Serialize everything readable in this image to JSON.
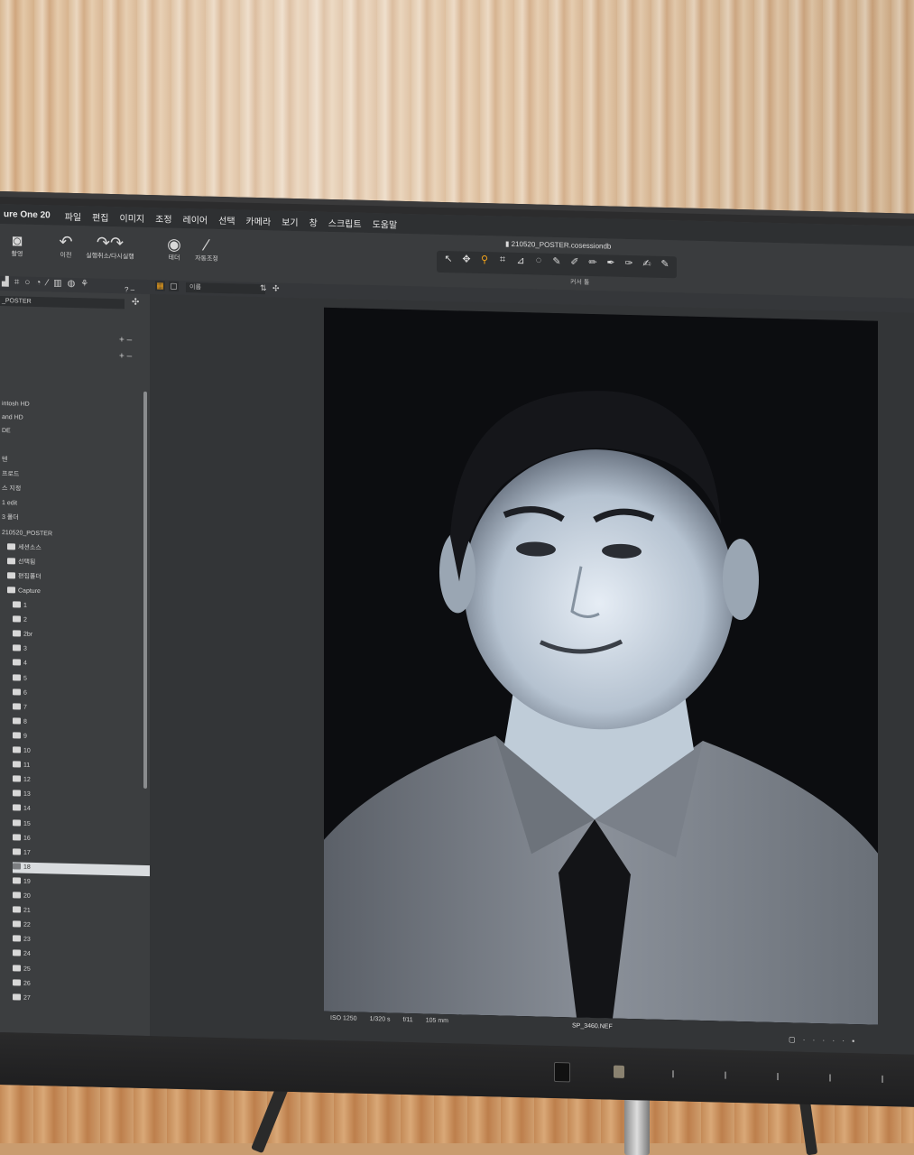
{
  "menubar": {
    "app_name": "ure One 20",
    "items": [
      "파일",
      "편집",
      "이미지",
      "조정",
      "레이어",
      "선택",
      "카메라",
      "보기",
      "창",
      "스크립트",
      "도움말"
    ]
  },
  "toolbar": {
    "document_title": "210520_POSTER.cosessiondb",
    "buttons": [
      {
        "label": "촬영",
        "icon": "camera-icon"
      },
      {
        "label": "이전",
        "icon": "undo-icon"
      },
      {
        "label": "실행취소/다시실행",
        "icon": "redo-icon"
      },
      {
        "label": "테더",
        "icon": "tether-icon"
      },
      {
        "label": "자동조정",
        "icon": "wand-icon"
      }
    ],
    "cursor_tools_label": "커서 툴"
  },
  "subbar": {
    "sort_value": "이름"
  },
  "library": {
    "session_name": "_POSTER",
    "rows": [
      {
        "label": "intosh HD",
        "folder": false,
        "selected": false
      },
      {
        "label": "and HD",
        "folder": false,
        "selected": false
      },
      {
        "label": "DE",
        "folder": false,
        "selected": false
      },
      {
        "label": "텐",
        "folder": false,
        "selected": false
      },
      {
        "label": "프로드",
        "folder": false,
        "selected": false
      },
      {
        "label": "스 지정",
        "folder": false,
        "selected": false
      },
      {
        "label": "1 edit",
        "folder": false,
        "selected": false
      },
      {
        "label": "3 폴더",
        "folder": false,
        "selected": false
      },
      {
        "label": "210520_POSTER",
        "folder": false,
        "selected": false
      },
      {
        "label": "세션소스",
        "folder": true,
        "selected": false
      },
      {
        "label": "선택됨",
        "folder": true,
        "selected": false
      },
      {
        "label": "편집폴더",
        "folder": true,
        "selected": false
      },
      {
        "label": "Capture",
        "folder": true,
        "selected": false
      },
      {
        "label": "1",
        "folder": true,
        "selected": false
      },
      {
        "label": "2",
        "folder": true,
        "selected": false
      },
      {
        "label": "2br",
        "folder": true,
        "selected": false
      },
      {
        "label": "3",
        "folder": true,
        "selected": false
      },
      {
        "label": "4",
        "folder": true,
        "selected": false
      },
      {
        "label": "5",
        "folder": true,
        "selected": false
      },
      {
        "label": "6",
        "folder": true,
        "selected": false
      },
      {
        "label": "7",
        "folder": true,
        "selected": false
      },
      {
        "label": "8",
        "folder": true,
        "selected": false
      },
      {
        "label": "9",
        "folder": true,
        "selected": false
      },
      {
        "label": "10",
        "folder": true,
        "selected": false
      },
      {
        "label": "11",
        "folder": true,
        "selected": false
      },
      {
        "label": "12",
        "folder": true,
        "selected": false
      },
      {
        "label": "13",
        "folder": true,
        "selected": false
      },
      {
        "label": "14",
        "folder": true,
        "selected": false
      },
      {
        "label": "15",
        "folder": true,
        "selected": false
      },
      {
        "label": "16",
        "folder": true,
        "selected": false
      },
      {
        "label": "17",
        "folder": true,
        "selected": false
      },
      {
        "label": "18",
        "folder": true,
        "selected": true
      },
      {
        "label": "19",
        "folder": true,
        "selected": false
      },
      {
        "label": "20",
        "folder": true,
        "selected": false
      },
      {
        "label": "21",
        "folder": true,
        "selected": false
      },
      {
        "label": "22",
        "folder": true,
        "selected": false
      },
      {
        "label": "23",
        "folder": true,
        "selected": false
      },
      {
        "label": "24",
        "folder": true,
        "selected": false
      },
      {
        "label": "25",
        "folder": true,
        "selected": false
      },
      {
        "label": "26",
        "folder": true,
        "selected": false
      },
      {
        "label": "27",
        "folder": true,
        "selected": false
      }
    ]
  },
  "viewer": {
    "iso": "ISO 1250",
    "shutter": "1/320 s",
    "aperture": "f/11",
    "focal_length": "105 mm",
    "filename": "SP_3460.NEF"
  },
  "colors": {
    "accent": "#f2a31b",
    "panel": "#3c3e40",
    "viewer_bg": "#333537"
  }
}
